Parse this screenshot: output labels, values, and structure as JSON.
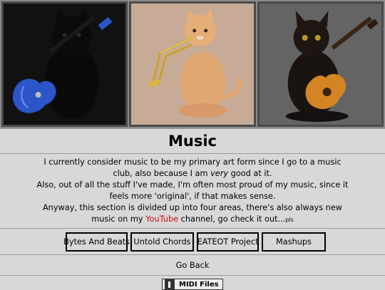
{
  "banner": {
    "images": [
      {
        "icon": "black-cat-with-blue-electric-guitar"
      },
      {
        "icon": "orange-cat-with-trombone"
      },
      {
        "icon": "black-cat-with-acoustic-guitar"
      }
    ]
  },
  "page": {
    "title": "Music"
  },
  "intro": {
    "p1_a": "I currently consider music to be my primary art form since I go to a music club, also because I am ",
    "p1_em": "very",
    "p1_b": " good at it.",
    "p2": "Also, out of all the stuff I've made, I'm often most proud of my music, since it feels more 'original', if that makes sense.",
    "p3_a": "Anyway, this section is divided up into four areas, there's also always new music on my ",
    "p3_link": "YouTube",
    "p3_b": " channel, go check it out...",
    "p3_small": "pls"
  },
  "nav": {
    "buttons": [
      "Bytes And Beats",
      "Untold Chords",
      "EATEOT Project",
      "Mashups"
    ]
  },
  "footer": {
    "go_back": "Go Back",
    "midi_label": "MIDI Files"
  },
  "colors": {
    "background": "#d8d8d8",
    "link": "#cc1111"
  }
}
